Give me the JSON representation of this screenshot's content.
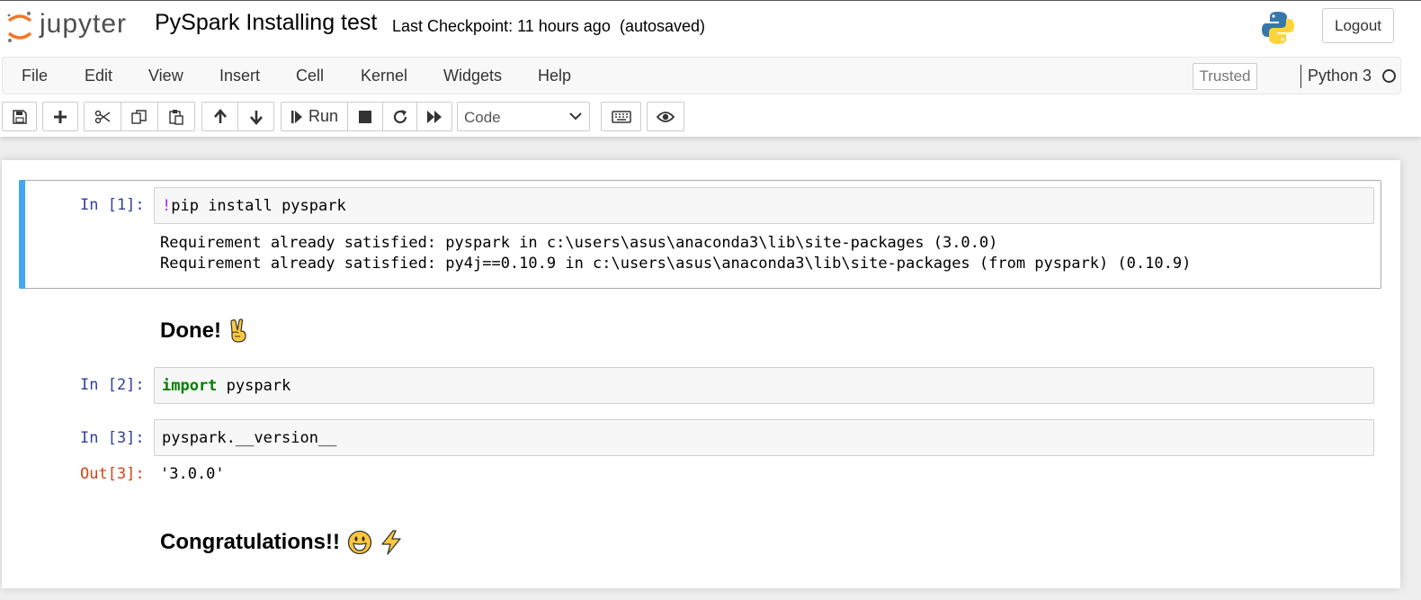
{
  "header": {
    "logo_text": "jupyter",
    "notebook_name": "PySpark Installing test",
    "checkpoint_text": "Last Checkpoint: 11 hours ago",
    "autosave_text": "(autosaved)",
    "logout_label": "Logout",
    "python_logo_icon": "python-logo-icon"
  },
  "menubar": {
    "items": [
      "File",
      "Edit",
      "View",
      "Insert",
      "Cell",
      "Kernel",
      "Widgets",
      "Help"
    ],
    "trusted_label": "Trusted",
    "kernel_name": "Python 3",
    "kernel_indicator_icon": "kernel-idle-circle-icon"
  },
  "toolbar": {
    "buttons": [
      "save-icon",
      "plus-icon",
      "cut-icon",
      "copy-icon",
      "paste-icon",
      "arrow-up-icon",
      "arrow-down-icon",
      "run-step-icon",
      "stop-icon",
      "restart-icon",
      "fast-forward-icon",
      "keyboard-icon",
      "eye-icon"
    ],
    "run_label": "Run",
    "cell_type": "Code"
  },
  "cells": {
    "c1": {
      "prompt": "In [1]:",
      "bang": "!",
      "code": "pip install pyspark",
      "output_lines": [
        "Requirement already satisfied: pyspark in c:\\users\\asus\\anaconda3\\lib\\site-packages (3.0.0)",
        "Requirement already satisfied: py4j==0.10.9 in c:\\users\\asus\\anaconda3\\lib\\site-packages (from pyspark) (0.10.9)"
      ]
    },
    "md1": {
      "text": "Done!",
      "icon": "victory-hand-emoji-icon"
    },
    "c2": {
      "prompt": "In [2]:",
      "keyword": "import",
      "code": " pyspark"
    },
    "c3": {
      "prompt": "In [3]:",
      "code": "pyspark.__version__",
      "out_prompt": "Out[3]:",
      "output": "'3.0.0'"
    },
    "md2": {
      "text": "Congratulations!!",
      "icons": [
        "grinning-face-emoji-icon",
        "lightning-emoji-icon"
      ]
    }
  },
  "colors": {
    "selected_cell_bar": "#42a5f5",
    "in_prompt": "#303f9f",
    "out_prompt": "#d84315",
    "keyword": "#008000",
    "bang": "#aa22ff",
    "jupyter_orange": "#f37726"
  }
}
